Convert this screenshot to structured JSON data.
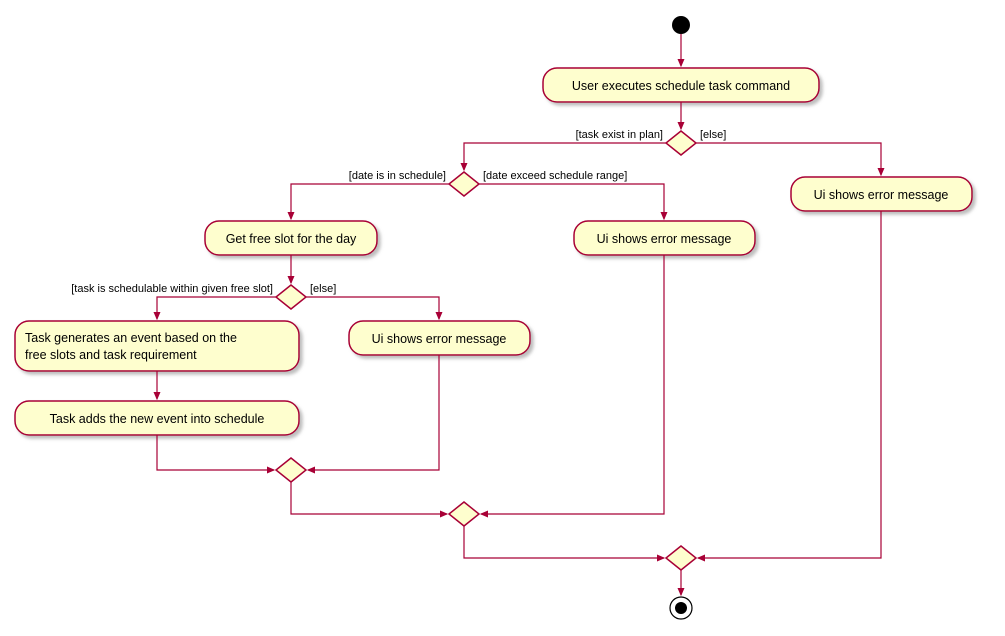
{
  "chart_data": {
    "type": "activity-diagram",
    "start": "start",
    "nodes": {
      "a1": "User executes schedule task command",
      "a2": "Get free slot for the day",
      "a3": "Task generates an event based on the free slots and task requirement",
      "a4": "Task adds the new event into schedule",
      "e1": "Ui shows error message",
      "e2": "Ui shows error message",
      "e3": "Ui shows error message"
    },
    "decisions": {
      "d1": {
        "true": "task exist in plan",
        "false": "else"
      },
      "d2": {
        "true": "date is in schedule",
        "false": "date exceed schedule range"
      },
      "d3": {
        "true": "task is schedulable within given free slot",
        "false": "else"
      }
    },
    "guards": {
      "g_task_exist": "[task exist in plan]",
      "g_else1": "[else]",
      "g_date_in": "[date is in schedule]",
      "g_date_exceed": "[date exceed schedule range]",
      "g_schedulable": "[task is schedulable within given free slot]",
      "g_else2": "[else]"
    }
  }
}
